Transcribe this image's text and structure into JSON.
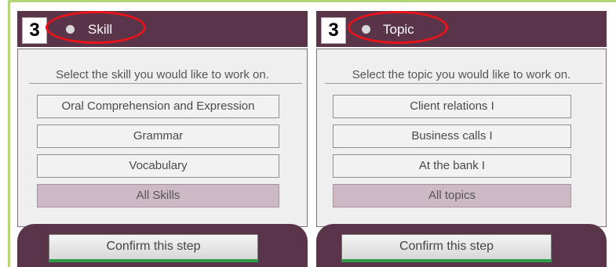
{
  "panels": [
    {
      "step": "3",
      "label": "Skill",
      "prompt": "Select the skill you would like to work on.",
      "options": [
        "Oral Comprehension and Expression",
        "Grammar",
        "Vocabulary"
      ],
      "all_label": "All Skills",
      "confirm_label": "Confirm this step"
    },
    {
      "step": "3",
      "label": "Topic",
      "prompt": "Select the topic you would like to work on.",
      "options": [
        "Client relations I",
        "Business calls I",
        "At the bank I"
      ],
      "all_label": "All topics",
      "confirm_label": "Confirm this step"
    }
  ],
  "colors": {
    "header_bg": "#5a3549",
    "selected_option_bg": "#cdb9c5",
    "highlight_ring": "#e8141a",
    "frame_accent": "#b3d67a",
    "confirm_underline": "#2a9d46"
  }
}
